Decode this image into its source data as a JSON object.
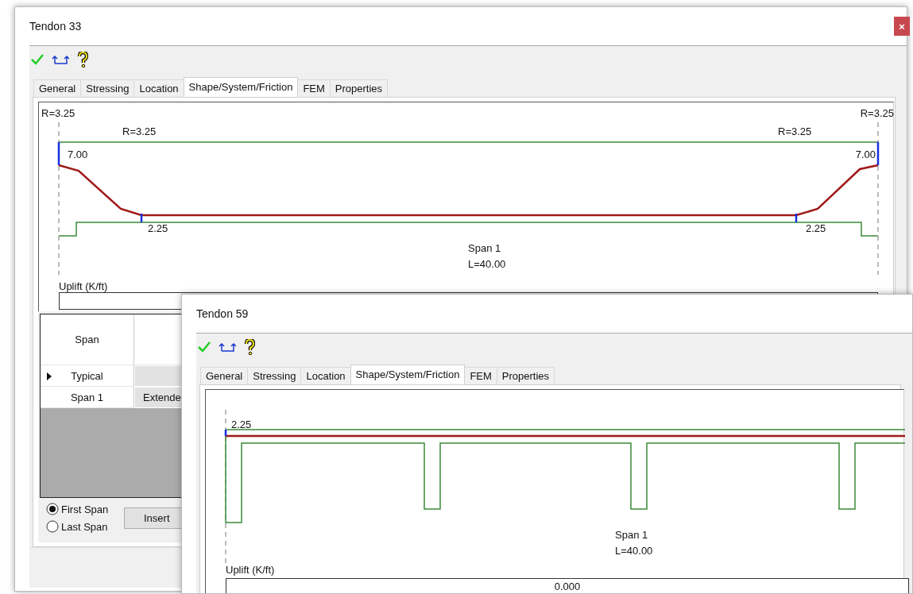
{
  "windows": [
    {
      "title": "Tendon 33",
      "close_label": "×",
      "tabs": [
        {
          "label": "General",
          "selected": false
        },
        {
          "label": "Stressing",
          "selected": false
        },
        {
          "label": "Location",
          "selected": false
        },
        {
          "label": "Shape/System/Friction",
          "selected": true
        },
        {
          "label": "FEM",
          "selected": false
        },
        {
          "label": "Properties",
          "selected": false
        }
      ],
      "diagram": {
        "kind": "tapered",
        "labels": [
          "R=3.25",
          "R=3.25",
          "R=3.25",
          "R=3.25",
          "7.00",
          "7.00",
          "2.25",
          "2.25"
        ],
        "span_label": "Span 1",
        "length_label": "L=40.00",
        "uplift_label": "Uplift (K/ft)"
      },
      "grid": {
        "columns": [
          "Span"
        ],
        "rows": [
          {
            "span": "Typical",
            "current": true,
            "column_2": ""
          },
          {
            "span": "Span 1",
            "current": false,
            "column_2": "Extende"
          }
        ]
      },
      "span_options": [
        {
          "label": "First Span",
          "selected": true
        },
        {
          "label": "Last Span",
          "selected": false
        }
      ],
      "insert_button": "Insert"
    },
    {
      "title": "Tendon 59",
      "tabs": [
        {
          "label": "General",
          "selected": false
        },
        {
          "label": "Stressing",
          "selected": false
        },
        {
          "label": "Location",
          "selected": false
        },
        {
          "label": "Shape/System/Friction",
          "selected": true
        },
        {
          "label": "FEM",
          "selected": false
        },
        {
          "label": "Properties",
          "selected": false
        }
      ],
      "diagram": {
        "kind": "flat",
        "labels": [
          "2.25"
        ],
        "span_label": "Span 1",
        "length_label": "L=40.00",
        "uplift_label": "Uplift (K/ft)",
        "uplift_value": "0.000"
      }
    }
  ]
}
